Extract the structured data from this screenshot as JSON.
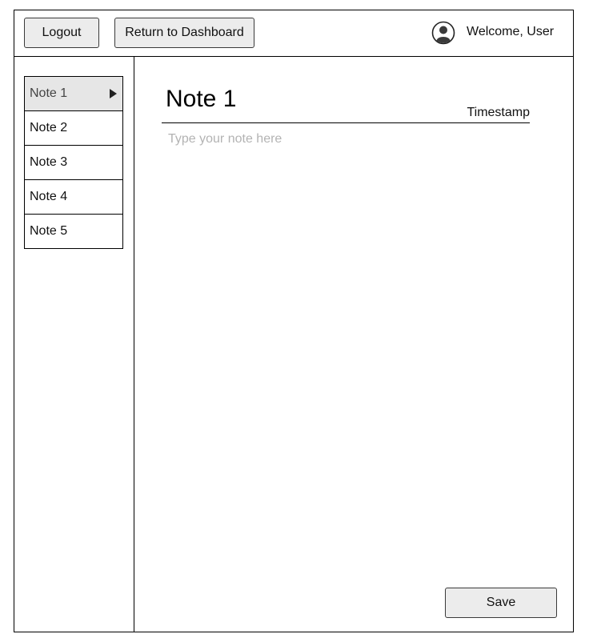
{
  "header": {
    "logout_label": "Logout",
    "dashboard_label": "Return to Dashboard",
    "welcome_text": "Welcome, User",
    "user_icon": "user-circle-icon"
  },
  "sidebar": {
    "items": [
      {
        "label": "Note 1",
        "selected": true
      },
      {
        "label": "Note 2",
        "selected": false
      },
      {
        "label": "Note 3",
        "selected": false
      },
      {
        "label": "Note 4",
        "selected": false
      },
      {
        "label": "Note 5",
        "selected": false
      }
    ],
    "selected_indicator_icon": "play-arrow-icon"
  },
  "editor": {
    "title": "Note 1",
    "timestamp": "Timestamp",
    "body_value": "",
    "body_placeholder": "Type your note here",
    "save_label": "Save"
  },
  "colors": {
    "button_bg": "#ececec",
    "selected_item_bg": "#e6e6e6",
    "placeholder": "#b3b3b3",
    "border": "#000000"
  }
}
